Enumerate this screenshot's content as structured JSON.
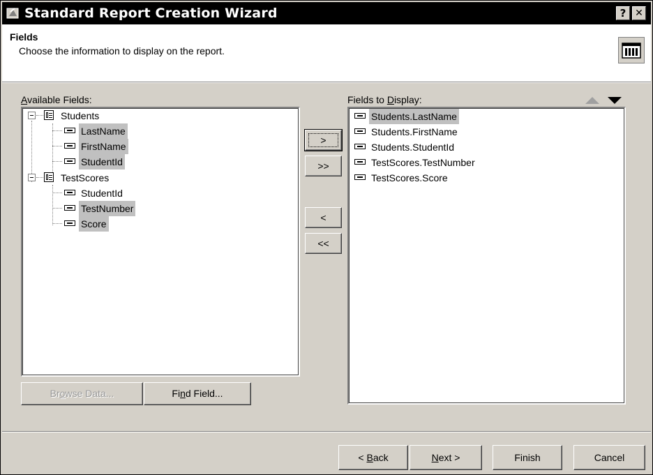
{
  "window": {
    "title": "Standard Report Creation Wizard",
    "help_label": "?",
    "close_label": "✕",
    "app_icon": "wizard-icon"
  },
  "header": {
    "title": "Fields",
    "subtitle": "Choose the information to display on the report.",
    "icon": "report-table-icon"
  },
  "available": {
    "label_prefix": "",
    "label_access": "A",
    "label_rest": "vailable Fields:",
    "tables": [
      {
        "name": "Students",
        "fields": [
          {
            "name": "LastName",
            "selected": true
          },
          {
            "name": "FirstName",
            "selected": true
          },
          {
            "name": "StudentId",
            "selected": true
          }
        ]
      },
      {
        "name": "TestScores",
        "fields": [
          {
            "name": "StudentId",
            "selected": false
          },
          {
            "name": "TestNumber",
            "selected": true
          },
          {
            "name": "Score",
            "selected": true
          }
        ]
      }
    ]
  },
  "display": {
    "label_prefix": "Fields to ",
    "label_access": "D",
    "label_rest": "isplay:",
    "fields": [
      {
        "name": "Students.LastName",
        "selected": true
      },
      {
        "name": "Students.FirstName",
        "selected": false
      },
      {
        "name": "Students.StudentId",
        "selected": false
      },
      {
        "name": "TestScores.TestNumber",
        "selected": false
      },
      {
        "name": "TestScores.Score",
        "selected": false
      }
    ]
  },
  "move_buttons": {
    "add": ">",
    "add_all": ">>",
    "remove": "<",
    "remove_all": "<<"
  },
  "buttons": {
    "browse_prefix": "Br",
    "browse_access": "o",
    "browse_rest": "wse Data...",
    "find_prefix": "Fi",
    "find_access": "n",
    "find_rest": "d Field...",
    "back_prefix": "< ",
    "back_access": "B",
    "back_rest": "ack",
    "next_prefix": "",
    "next_access": "N",
    "next_rest": "ext >",
    "finish": "Finish",
    "cancel": "Cancel"
  }
}
